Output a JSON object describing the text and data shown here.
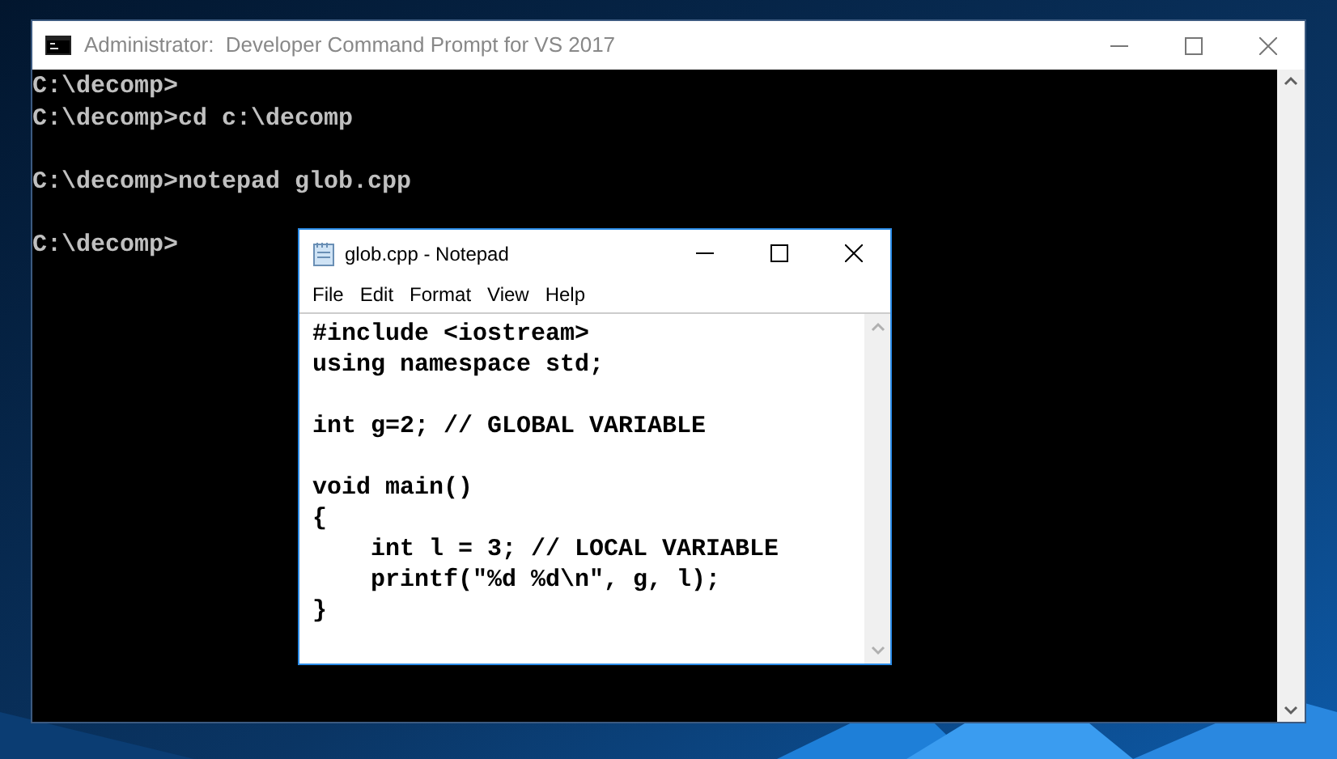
{
  "console_window": {
    "title": "Administrator:  Developer Command Prompt for VS 2017",
    "blocks": [
      [
        "C:\\decomp>",
        "C:\\decomp>cd c:\\decomp"
      ],
      [
        "C:\\decomp>notepad glob.cpp"
      ],
      [
        "C:\\decomp>"
      ]
    ]
  },
  "notepad_window": {
    "title": "glob.cpp - Notepad",
    "menu": [
      "File",
      "Edit",
      "Format",
      "View",
      "Help"
    ],
    "blocks": [
      [
        "#include <iostream>",
        "using namespace std;"
      ],
      [
        "int g=2; // GLOBAL VARIABLE"
      ],
      [
        "void main()",
        "{",
        "    int l = 3; // LOCAL VARIABLE",
        "    printf(\"%d %d\\n\", g, l);",
        "}"
      ]
    ]
  }
}
